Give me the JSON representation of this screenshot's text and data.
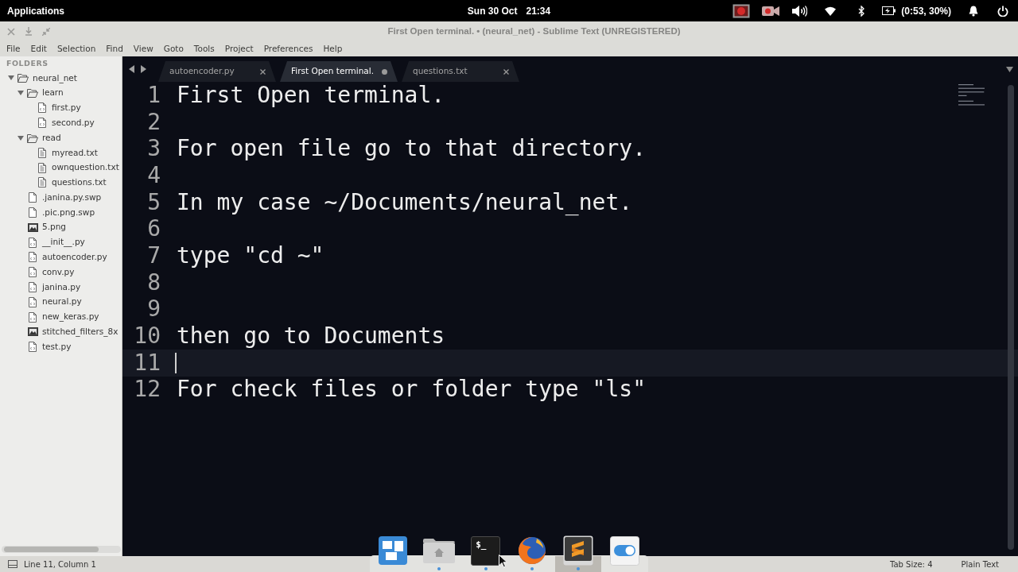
{
  "top_panel": {
    "applications_menu": "Applications",
    "date": "Sun 30 Oct",
    "time": "21:34",
    "battery": "(0:53, 30%)"
  },
  "window": {
    "title": "First Open terminal. • (neural_net) - Sublime Text (UNREGISTERED)"
  },
  "menu_bar": [
    "File",
    "Edit",
    "Selection",
    "Find",
    "View",
    "Goto",
    "Tools",
    "Project",
    "Preferences",
    "Help"
  ],
  "sidebar": {
    "header": "FOLDERS",
    "tree": [
      {
        "label": "neural_net",
        "kind": "folder",
        "expanded": true,
        "children": [
          {
            "label": "learn",
            "kind": "folder",
            "expanded": true,
            "children": [
              {
                "label": "first.py",
                "kind": "script"
              },
              {
                "label": "second.py",
                "kind": "script"
              }
            ]
          },
          {
            "label": "read",
            "kind": "folder",
            "expanded": true,
            "children": [
              {
                "label": "myread.txt",
                "kind": "text"
              },
              {
                "label": "ownquestion.txt",
                "kind": "text"
              },
              {
                "label": "questions.txt",
                "kind": "text"
              }
            ]
          },
          {
            "label": ".janina.py.swp",
            "kind": "blank"
          },
          {
            "label": ".pic.png.swp",
            "kind": "blank"
          },
          {
            "label": "5.png",
            "kind": "image"
          },
          {
            "label": "__init__.py",
            "kind": "script"
          },
          {
            "label": "autoencoder.py",
            "kind": "script"
          },
          {
            "label": "conv.py",
            "kind": "script"
          },
          {
            "label": "janina.py",
            "kind": "script"
          },
          {
            "label": "neural.py",
            "kind": "script"
          },
          {
            "label": "new_keras.py",
            "kind": "script"
          },
          {
            "label": "stitched_filters_8x",
            "kind": "image"
          },
          {
            "label": "test.py",
            "kind": "script"
          }
        ]
      }
    ]
  },
  "tabs": [
    {
      "label": "autoencoder.py",
      "selected": false,
      "modified": false
    },
    {
      "label": "First Open terminal.",
      "selected": true,
      "modified": true
    },
    {
      "label": "questions.txt",
      "selected": false,
      "modified": false
    }
  ],
  "editor": {
    "lines": [
      {
        "number": "1",
        "text": "First Open terminal.",
        "current": false
      },
      {
        "number": "2",
        "current": false
      },
      {
        "number": "3",
        "text": "For open file go to that directory.",
        "current": false
      },
      {
        "number": "4",
        "current": false
      },
      {
        "number": "5",
        "text": "In my case ~/Documents/neural_net.",
        "current": false
      },
      {
        "number": "6",
        "current": false
      },
      {
        "number": "7",
        "text": "type \"cd ~\"",
        "current": false
      },
      {
        "number": "8",
        "current": false
      },
      {
        "number": "9",
        "current": false
      },
      {
        "number": "10",
        "text": "then go to Documents",
        "current": false
      },
      {
        "number": "11",
        "current": true
      },
      {
        "number": "12",
        "text": "For check files or folder type \"ls\"",
        "current": false
      }
    ]
  },
  "status_bar": {
    "position": "Line 11, Column 1",
    "tab_size": "Tab Size: 4",
    "syntax": "Plain Text"
  },
  "dock": [
    {
      "kind": "multitasking",
      "running": false,
      "focused": false
    },
    {
      "kind": "files",
      "running": true,
      "focused": false
    },
    {
      "kind": "terminal",
      "label": "$_",
      "running": true,
      "focused": false
    },
    {
      "kind": "browser",
      "running": true,
      "focused": false
    },
    {
      "kind": "editor",
      "running": true,
      "focused": true
    },
    {
      "kind": "settings",
      "running": false,
      "focused": false
    }
  ]
}
